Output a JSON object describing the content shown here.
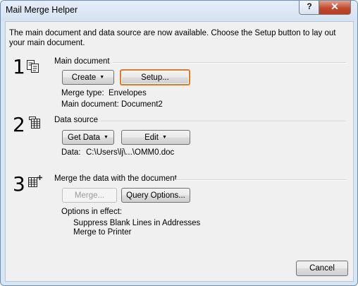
{
  "dialog": {
    "title": "Mail Merge Helper",
    "help_glyph": "?",
    "close_glyph": "✕",
    "intro": "The main document and data source are now available. Choose the Setup button to lay out your main document."
  },
  "steps": [
    {
      "number": "1",
      "title": "Main document",
      "buttons": {
        "create": "Create",
        "setup": "Setup..."
      },
      "merge_type_label": "Merge type:",
      "merge_type_value": "Envelopes",
      "main_doc_label": "Main document:",
      "main_doc_value": "Document2"
    },
    {
      "number": "2",
      "title": "Data source",
      "buttons": {
        "get_data": "Get Data",
        "edit": "Edit"
      },
      "data_label": "Data:",
      "data_value": "C:\\Users\\lj\\...\\OMM0.doc"
    },
    {
      "number": "3",
      "title": "Merge the data with the document",
      "buttons": {
        "merge": "Merge...",
        "query": "Query Options..."
      },
      "options_label": "Options in effect:",
      "options": [
        "Suppress Blank Lines in Addresses",
        "Merge to Printer"
      ]
    }
  ],
  "footer": {
    "cancel": "Cancel"
  },
  "icons": [
    "doc-icon",
    "table-icon",
    "merge-table-icon",
    "dropdown-arrow-icon"
  ]
}
